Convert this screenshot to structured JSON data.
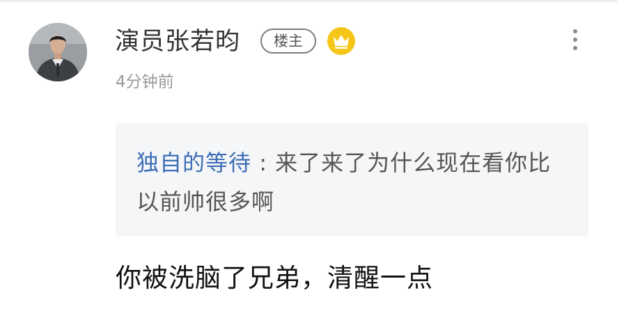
{
  "comment": {
    "username": "演员张若昀",
    "op_badge": "楼主",
    "crown_icon": "crown-icon",
    "more_icon": "more-vertical-icon",
    "timestamp": "4分钟前",
    "quote": {
      "author": "独自的等待",
      "separator": ":",
      "text": "来了来了为什么现在看你比以前帅很多啊"
    },
    "reply": "你被洗脑了兄弟，清醒一点"
  },
  "colors": {
    "username": "#333333",
    "timestamp": "#999999",
    "quote_author": "#3d6eb5",
    "quote_text": "#555555",
    "quote_background": "#f5f6f8",
    "crown_badge": "#f5c518",
    "reply_text": "#111111"
  }
}
